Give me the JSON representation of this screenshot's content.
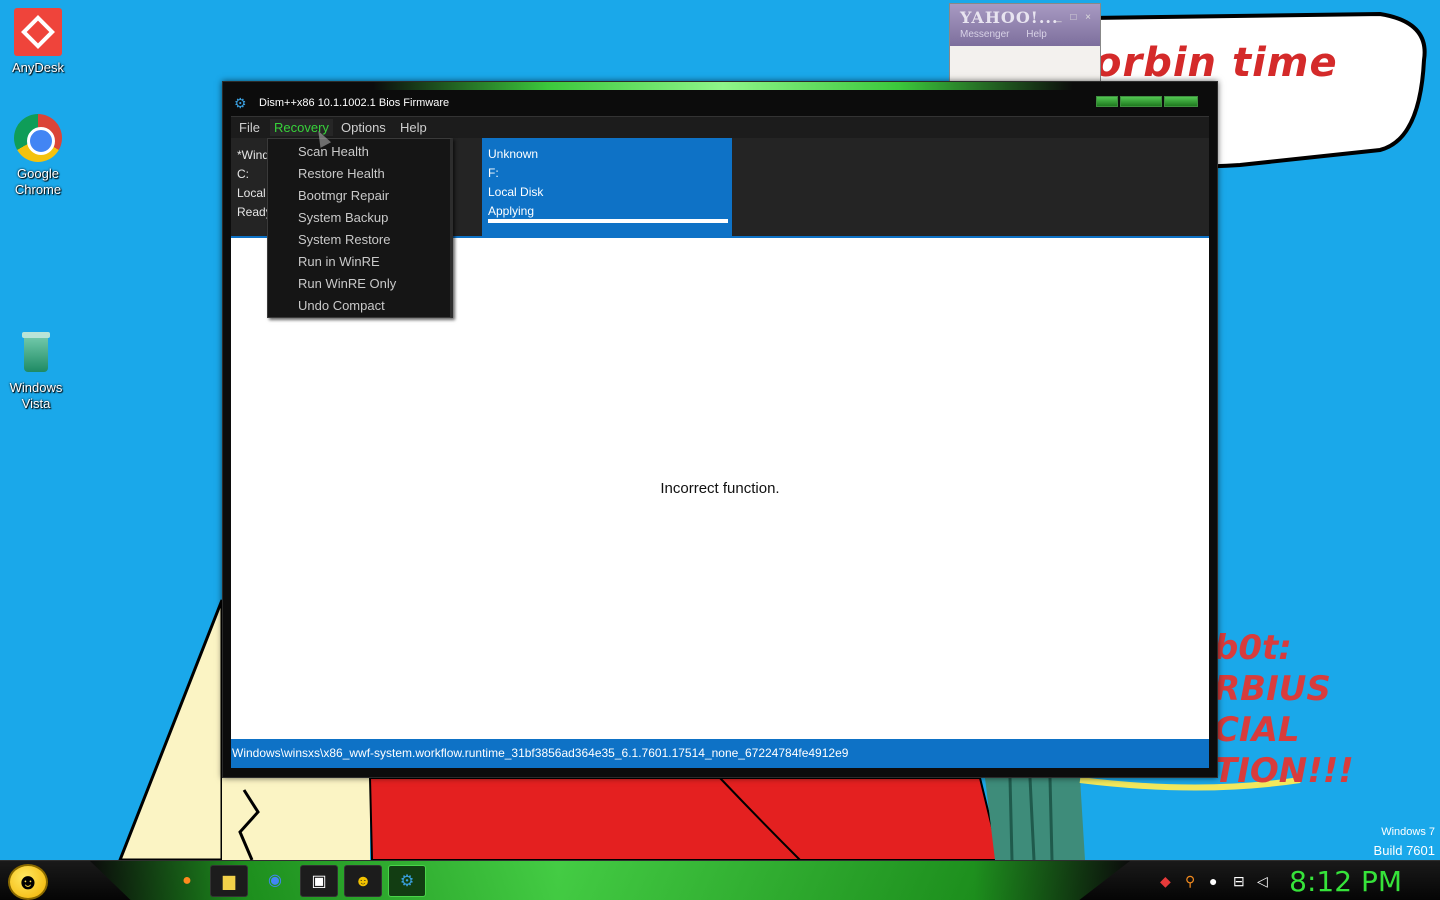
{
  "desktop": {
    "icons": [
      {
        "label": "AnyDesk"
      },
      {
        "label": "Google Chrome"
      },
      {
        "label": "Windows Vista"
      }
    ],
    "wallpaper_texts": {
      "speech": "orbin  time",
      "lines": [
        "b0t:",
        "RBIUS",
        "CIAL",
        "TION!!!"
      ]
    },
    "watermark": {
      "line1": "Windows 7",
      "line2": "Build 7601"
    }
  },
  "yahoo": {
    "title": "YAHOO!...",
    "controls": "_ □ ×",
    "menu": [
      "Messenger",
      "Help"
    ]
  },
  "window": {
    "title": "Dism++x86 10.1.1002.1 Bios Firmware",
    "menubar": [
      "File",
      "Recovery",
      "Options",
      "Help"
    ],
    "active_menu": "Recovery",
    "left_panel": [
      "*Windows 7",
      "C:",
      "Local Disk",
      "Ready"
    ],
    "card": {
      "lines": [
        "Unknown",
        "F:",
        "Local Disk",
        "Applying"
      ],
      "progress": 1.0
    },
    "message": "Incorrect function.",
    "status": "Windows\\winsxs\\x86_wwf-system.workflow.runtime_31bf3856ad364e35_6.1.7601.17514_none_67224784fe4912e9"
  },
  "recovery_menu": [
    "Scan Health",
    "Restore Health",
    "Bootmgr Repair",
    "System Backup",
    "System Restore",
    "Run in WinRE",
    "Run WinRE Only",
    "Undo Compact"
  ],
  "taskbar": {
    "apps": [
      "firefox-icon",
      "folder-icon",
      "chrome-icon",
      "media-icon",
      "smiley-icon",
      "dism-icon"
    ],
    "clock": "8:12 PM"
  },
  "colors": {
    "accent_green": "#37d23a",
    "selection_blue": "#0e72c6"
  }
}
